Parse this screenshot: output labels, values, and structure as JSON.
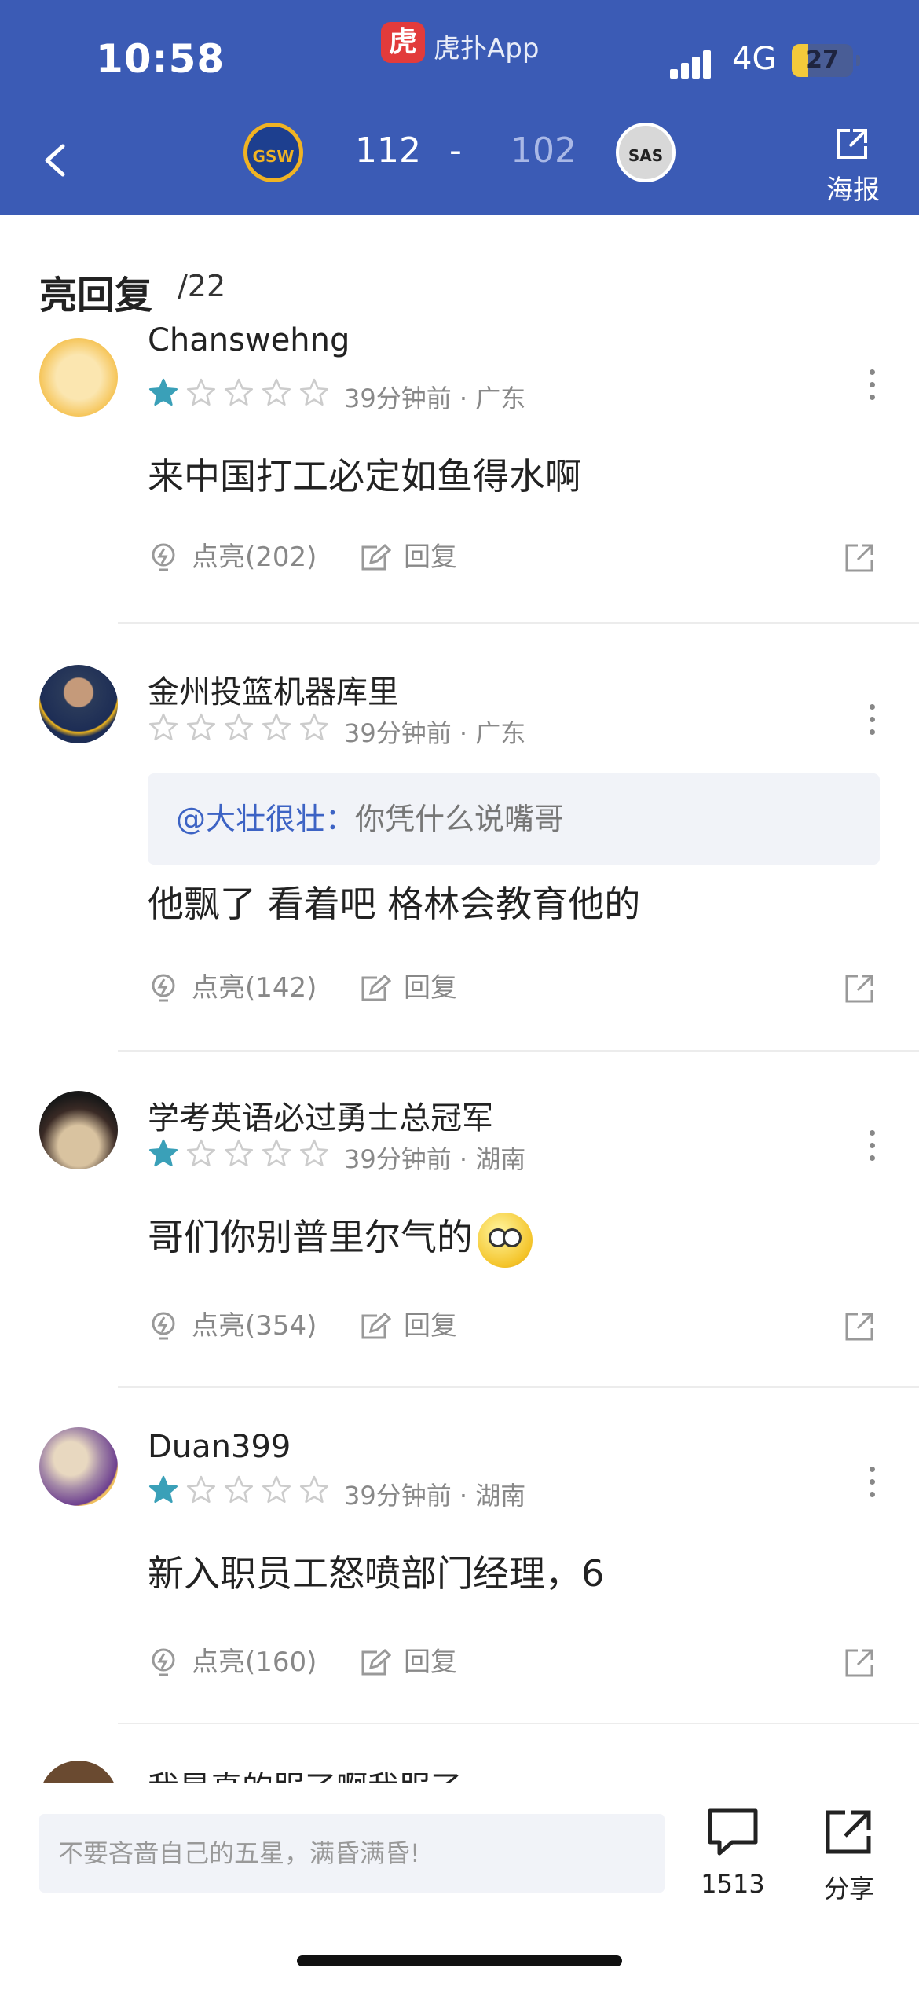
{
  "status_bar": {
    "time": "10:58",
    "app_badge": "虎",
    "app_name": "虎扑App",
    "network": "4G",
    "battery": "27",
    "battery_level": 0.27
  },
  "game": {
    "home": {
      "abbr": "GSW",
      "score": "112"
    },
    "separator": "-",
    "away": {
      "abbr": "SAS",
      "score": "102"
    },
    "poster_label": "海报"
  },
  "section": {
    "title": "亮回复",
    "count": "/22"
  },
  "comments": [
    {
      "username": "Chanswehng",
      "rating": 1,
      "meta": "39分钟前 · 广东",
      "text": "来中国打工必定如鱼得水啊",
      "likes": "点亮(202)",
      "reply_label": "回复"
    },
    {
      "username": "金州投篮机器库里",
      "rating": 0,
      "meta": "39分钟前 · 广东",
      "quote_user": "@大壮很壮：",
      "quote_text": "你凭什么说嘴哥",
      "text": "他飘了 看着吧 格林会教育他的",
      "likes": "点亮(142)",
      "reply_label": "回复"
    },
    {
      "username": "学考英语必过勇士总冠军",
      "rating": 1,
      "meta": "39分钟前 · 湖南",
      "text": "哥们你别普里尔气的",
      "emoji": "flushed-face",
      "likes": "点亮(354)",
      "reply_label": "回复"
    },
    {
      "username": "Duan399",
      "rating": 1,
      "meta": "39分钟前 · 湖南",
      "text": "新入职员工怒喷部门经理，6",
      "likes": "点亮(160)",
      "reply_label": "回复"
    },
    {
      "username": "我是真的服了啊我服了"
    }
  ],
  "bottom_bar": {
    "input_placeholder": "不要吝啬自己的五星，满昏满昏!",
    "comment_count": "1513",
    "share_label": "分享"
  },
  "colors": {
    "header_bg": "#3b5bb5",
    "star_filled": "#3aa0b8",
    "star_empty": "#cccccc",
    "mention": "#3d63c4",
    "battery": "#f3c93b"
  }
}
